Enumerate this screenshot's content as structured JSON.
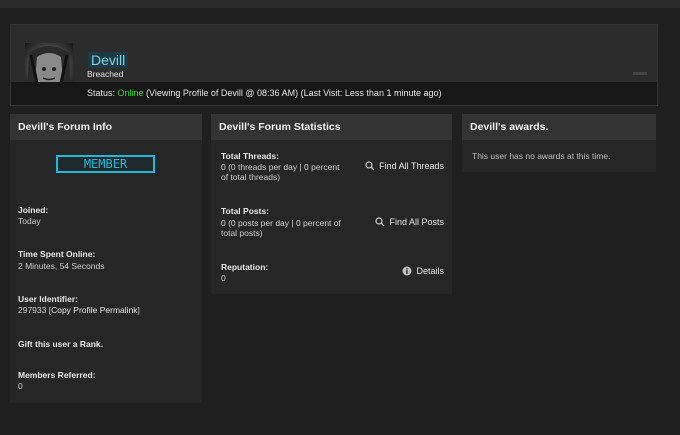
{
  "profile": {
    "username": "Devill",
    "user_title": "Breached",
    "status_label": "Status: ",
    "status_value": "Online",
    "status_detail": " (Viewing Profile of Devill @ 08:36 AM) (Last Visit: Less than 1 minute ago)"
  },
  "forum_info": {
    "title": "Devill's Forum Info",
    "rank": "MEMBER",
    "joined_label": "Joined:",
    "joined_value": "Today",
    "time_online_label": "Time Spent Online:",
    "time_online_value": "2 Minutes, 54 Seconds",
    "uid_label": "User Identifier:",
    "uid_value": "297933 [",
    "uid_link": "Copy Profile Permalink",
    "uid_close": "]",
    "gift_label": "Gift this user a Rank.",
    "referred_label": "Members Referred:",
    "referred_value": "0"
  },
  "stats": {
    "title": "Devill's Forum Statistics",
    "threads_label": "Total Threads:",
    "threads_value_1": "0 (0 threads per day | 0 percent",
    "threads_value_2": "of total threads)",
    "find_threads": "Find All Threads",
    "posts_label": "Total Posts:",
    "posts_value_1": "0 (0 posts per day | 0 percent of",
    "posts_value_2": "total posts)",
    "find_posts": "Find All Posts",
    "rep_label": "Reputation:",
    "rep_value": "0",
    "details": "Details"
  },
  "awards": {
    "title": "Devill's awards.",
    "message": "This user has no awards at this time."
  },
  "colors": {
    "accent": "#29b6d6",
    "online": "#3ecf3e",
    "username": "#7fd3e6"
  },
  "icons": [
    "search-icon",
    "info-icon"
  ]
}
